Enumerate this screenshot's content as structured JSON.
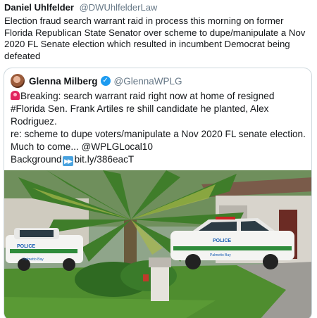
{
  "tweet": {
    "author_name": "Daniel Uhlfelder",
    "author_handle": "@DWUhlfelderLaw",
    "text": "Election fraud search warrant raid in process this morning on former Florida Republican State Senator over scheme to dupe/manipulate a Nov 2020 FL Senate election which resulted in incumbent Democrat being defeated"
  },
  "quote": {
    "author_name": "Glenna Milberg",
    "verified_icon": "verified-badge-icon",
    "author_handle": "@GlennaWPLG",
    "lines": {
      "breaking": "Breaking: search warrant raid right now at home of resigned #Florida Sen. Frank Artiles re shill candidate he planted, Alex Rodriguez.",
      "scheme": "re: scheme to dupe voters/manipulate a Nov 2020 FL senate election. Much to come... @WPLGLocal10",
      "background_label": "Background",
      "link": "bit.ly/386eacT"
    },
    "icons": {
      "siren": "police-siren-icon",
      "fast_forward": "fast-forward-icon"
    },
    "media": {
      "car_left_label": "POLICE",
      "car_left_sublabel": "Palmetto Bay",
      "car_right_label": "POLICE",
      "car_right_sublabel": "Palmetto Bay"
    }
  },
  "colors": {
    "text": "#14171a",
    "secondary": "#657786",
    "border": "#cfd9de",
    "verified": "#1d9bf0"
  }
}
